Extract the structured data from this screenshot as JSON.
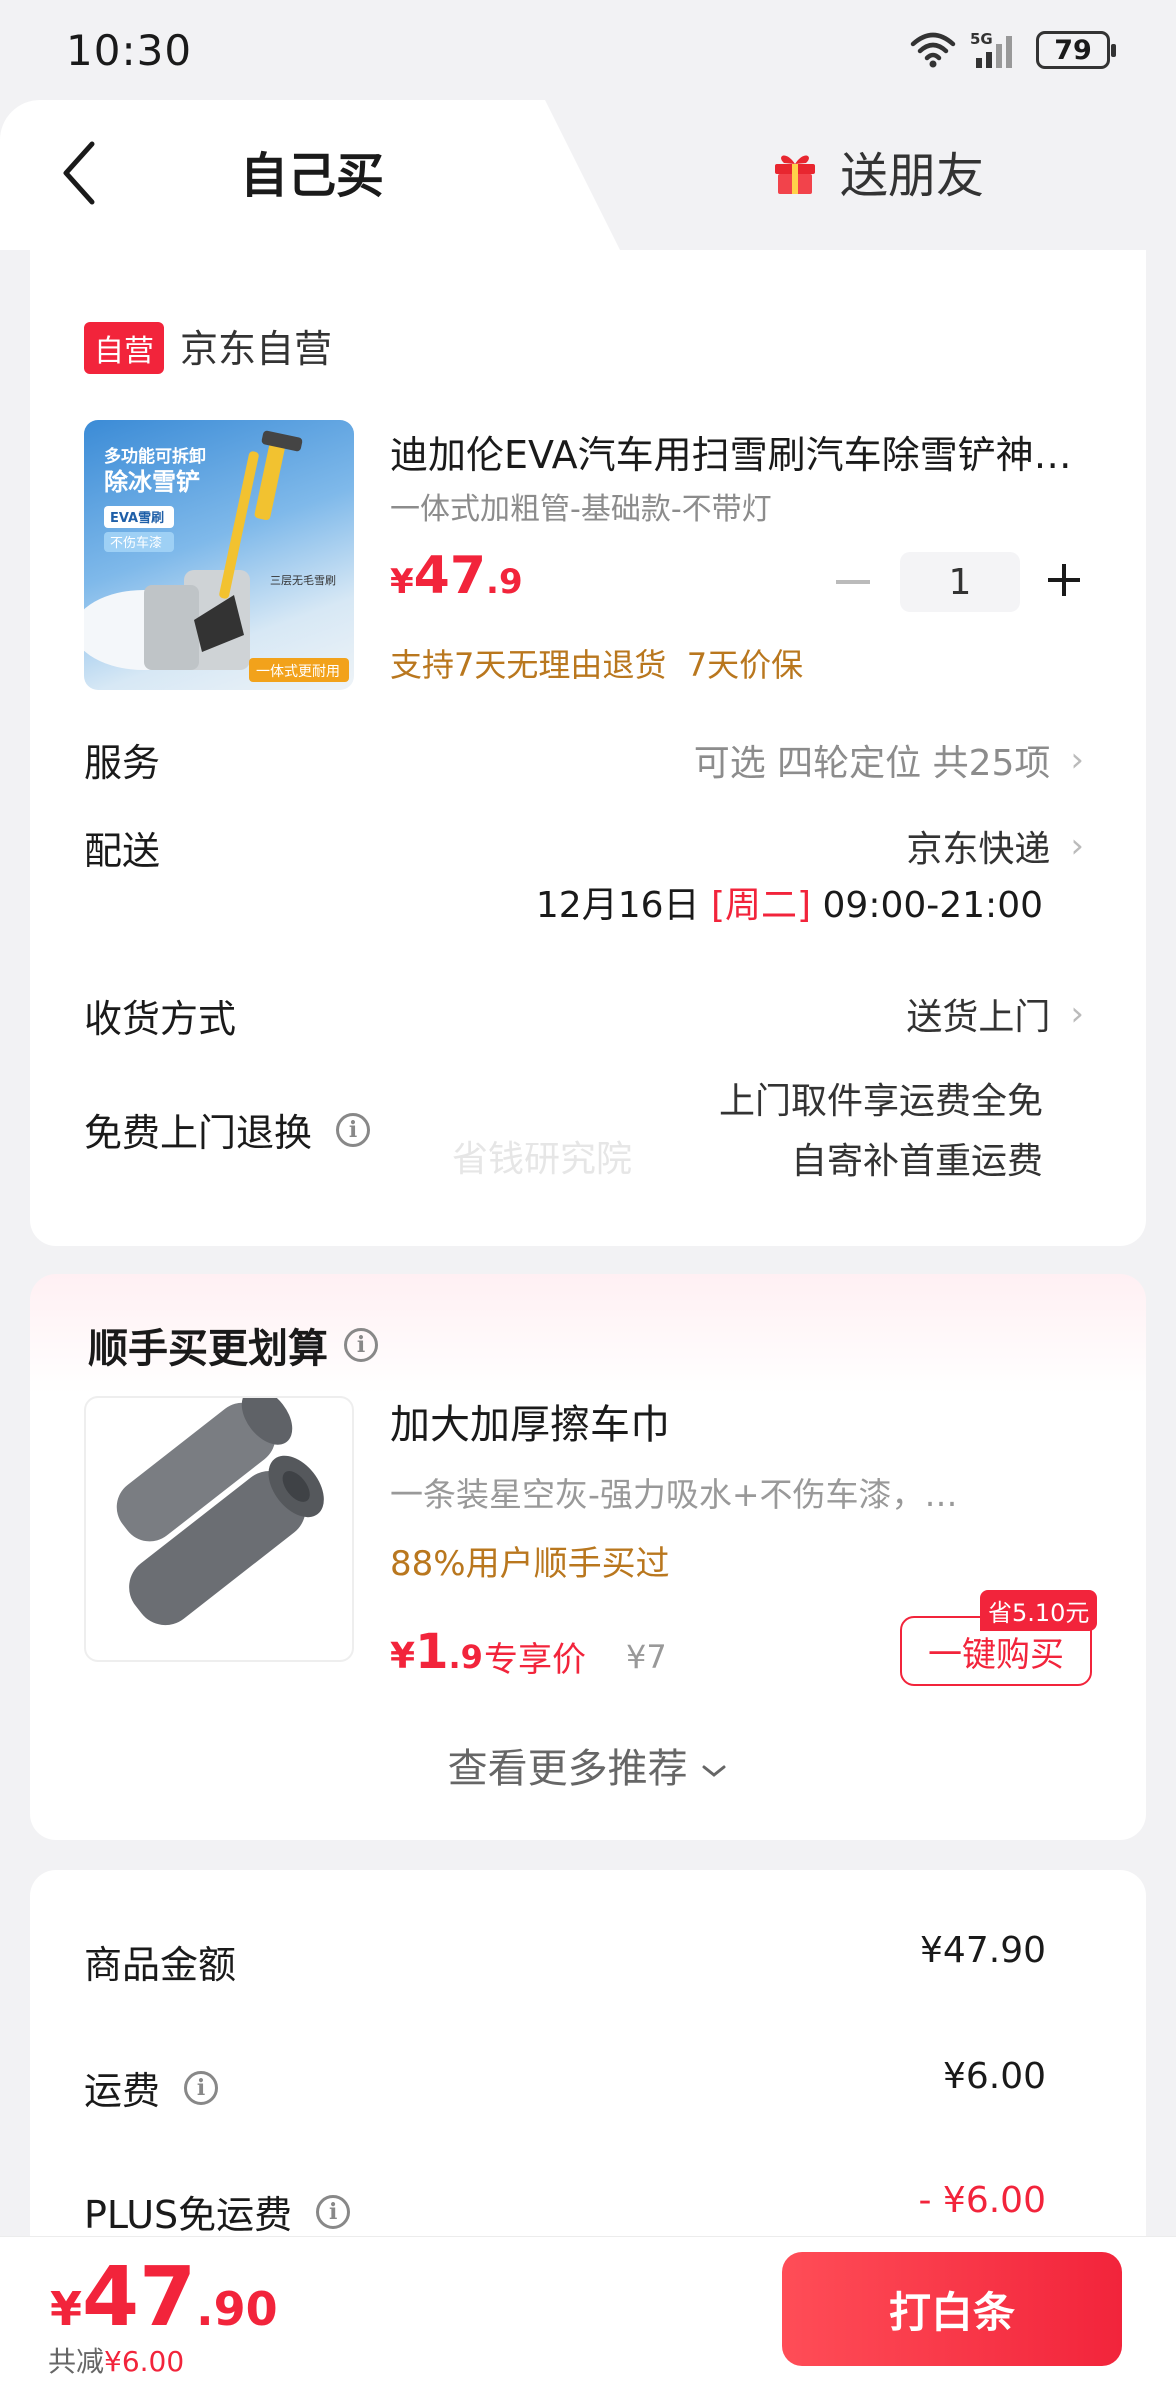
{
  "status_bar": {
    "time": "10:30",
    "network": "5G",
    "battery": "79"
  },
  "tabs": {
    "self_buy": "自己买",
    "gift": "送朋友"
  },
  "shop": {
    "badge": "自营",
    "name": "京东自营"
  },
  "product": {
    "title": "迪加伦EVA汽车用扫雪刷汽车除雪铲神…",
    "spec": "一体式加粗管-基础款-不带灯",
    "price_currency": "¥",
    "price_int": "47",
    "price_dec": ".9",
    "quantity": "1",
    "promise": "支持7天无理由退货  7天价保",
    "image_text": {
      "line1": "多功能可拆卸",
      "line2": "除冰雪铲",
      "tag1": "EVA雪刷",
      "tag2": "不伤车漆",
      "tag3": "三层无毛雪刷",
      "tag4": "一体式更耐用"
    }
  },
  "rows": {
    "service_label": "服务",
    "service_value": "可选 四轮定位 共25项",
    "delivery_label": "配送",
    "delivery_value": "京东快递",
    "delivery_date": "12月16日",
    "delivery_weekday": "[周二]",
    "delivery_time": "09:00-21:00",
    "receive_label": "收货方式",
    "receive_value": "送货上门",
    "return_label": "免费上门退换",
    "return_value_1": "上门取件享运费全免",
    "return_value_2": "自寄补首重运费",
    "watermark": "省钱研究院"
  },
  "recommendation": {
    "section_title": "顺手买更划算",
    "name": "加大加厚擦车巾",
    "desc": "一条装星空灰-强力吸水+不伤车漆，…",
    "buyers": "88%用户顺手买过",
    "price_currency": "¥",
    "price_int": "1",
    "price_dec": ".9",
    "exclusive": "专享价",
    "orig_price": "¥7",
    "save_badge": "省5.10元",
    "buy_label": "一键购买",
    "more": "查看更多推荐"
  },
  "summary": {
    "goods_label": "商品金额",
    "goods_value": "¥47.90",
    "shipping_label": "运费",
    "shipping_value": "¥6.00",
    "plus_label": "PLUS免运费",
    "plus_value": "- ¥6.00"
  },
  "bottom": {
    "currency": "¥",
    "total_int": "47",
    "total_dec": ".90",
    "discount_prefix": "共减",
    "discount_value": "¥6.00",
    "pay_label": "打白条"
  },
  "colors": {
    "accent_red": "#f2243b",
    "promise_gold": "#b9771e"
  }
}
